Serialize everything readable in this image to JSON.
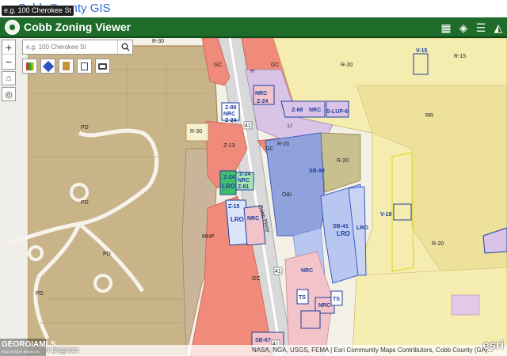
{
  "browser": {
    "site_title": "Cobb County GIS",
    "search_tooltip": "e.g. 100 Cherokee St"
  },
  "app": {
    "title": "Cobb Zoning Viewer"
  },
  "toolbar": {
    "tools": [
      {
        "name": "basemap-gallery-icon",
        "glyph": "▦"
      },
      {
        "name": "layers-icon",
        "glyph": "◈"
      },
      {
        "name": "legend-icon",
        "glyph": "☰"
      },
      {
        "name": "graduation-cap-icon",
        "glyph": "◭"
      }
    ]
  },
  "search": {
    "placeholder": "e.g. 100 Cherokee St"
  },
  "zoom": {
    "in_label": "+",
    "out_label": "−"
  },
  "map": {
    "zones": {
      "r30_top": "R-30",
      "gc_1": "GC",
      "gc_2": "GC",
      "h": "H",
      "nrc_1": "NRC",
      "z_1": "Z-24",
      "z_2": "Z-88",
      "nrc_2": "NRC",
      "z_3": "Z-68",
      "li": "LI",
      "z_4": "Z-24",
      "z_5": "Z-45",
      "r20_1": "R-20",
      "gc_3": "GC",
      "r20_2": "R-20",
      "r30_mid": "R-30",
      "z_6": "Z-13",
      "sb_1": "SB-90",
      "z_7": "Z-24",
      "lro_1": "LRO",
      "nrc_3": "NRC",
      "z_8": "Z-81",
      "z_9": "Z-24",
      "oi": "O&I",
      "z_10": "Z-15",
      "lro_2": "LRO",
      "nrc_4": "NRC",
      "sb_2": "SB-41",
      "lro_3": "LRO",
      "lro_4": "LRO",
      "mhp": "MHP",
      "pd_1": "PD",
      "pd_2": "PD",
      "pd_3": "PD",
      "pd_4": "PD",
      "r15_top": "R-15",
      "r20_3": "R-20",
      "r20_4": "R-20",
      "rr": "RR",
      "v_1": "V-15",
      "v_2": "V-18",
      "nrc_5": "NRC",
      "ts_1": "TS",
      "ts_2": "TS",
      "nrc_6": "NRC",
      "nrc_7": "NRC",
      "gc_4": "GC",
      "ucm": "S-LUP-6",
      "sb_3": "SB-67",
      "road": "Cobb Pkwy",
      "route": "41",
      "route_2": "41",
      "route_3": "41"
    }
  },
  "attribution": {
    "text": "NASA, NGA, USGS, FEMA | Esri Community Maps Contributors, Cobb County (GA)...",
    "esri": "esri"
  },
  "badge": {
    "brand": "GEORGIAMLS",
    "sub": "REAL ESTATE SERVICES",
    "degrees": "4 Degrees"
  },
  "colors": {
    "appbar": "#1e6b2a",
    "pd": "#c9b48a",
    "r20": "#f5ecb0",
    "gc": "#f08a7a",
    "nrc": "#f2c3c8",
    "li": "#d9c4e8",
    "oi": "#8fa2dc"
  }
}
